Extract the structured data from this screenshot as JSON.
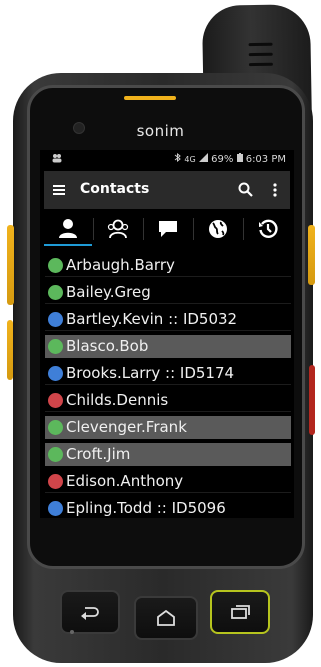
{
  "device": {
    "brand": "sonim"
  },
  "status_bar": {
    "signal_text": "4G",
    "battery": "69%",
    "time": "6:03 PM"
  },
  "app_bar": {
    "title": "Contacts",
    "icons": [
      "menu-icon",
      "search-icon",
      "more-vert-icon"
    ]
  },
  "tabs": [
    {
      "icon": "person-icon",
      "active": true
    },
    {
      "icon": "group-icon",
      "active": false
    },
    {
      "icon": "chat-icon",
      "active": false
    },
    {
      "icon": "globe-icon",
      "active": false
    },
    {
      "icon": "history-icon",
      "active": false
    }
  ],
  "colors": {
    "accent": "#1f9bd6",
    "status_green": "#5cb85c",
    "status_blue": "#3f7fd8",
    "status_red": "#d0454a",
    "selected_row": "#5a5a5a",
    "device_yellow": "#f0b21c",
    "recent_key": "#b6c41e"
  },
  "contacts": [
    {
      "name": "Arbaugh.Barry",
      "status": "green",
      "selected": false
    },
    {
      "name": "Bailey.Greg",
      "status": "green",
      "selected": false
    },
    {
      "name": "Bartley.Kevin :: ID5032",
      "status": "blue",
      "selected": false
    },
    {
      "name": "Blasco.Bob",
      "status": "green",
      "selected": true
    },
    {
      "name": "Brooks.Larry :: ID5174",
      "status": "blue",
      "selected": false
    },
    {
      "name": "Childs.Dennis",
      "status": "red",
      "selected": false
    },
    {
      "name": "Clevenger.Frank",
      "status": "green",
      "selected": true
    },
    {
      "name": "Croft.Jim",
      "status": "green",
      "selected": true
    },
    {
      "name": "Edison.Anthony",
      "status": "red",
      "selected": false
    },
    {
      "name": "Epling.Todd :: ID5096",
      "status": "blue",
      "selected": false
    }
  ],
  "hardware_keys": [
    "back-icon",
    "home-icon",
    "recents-icon"
  ]
}
